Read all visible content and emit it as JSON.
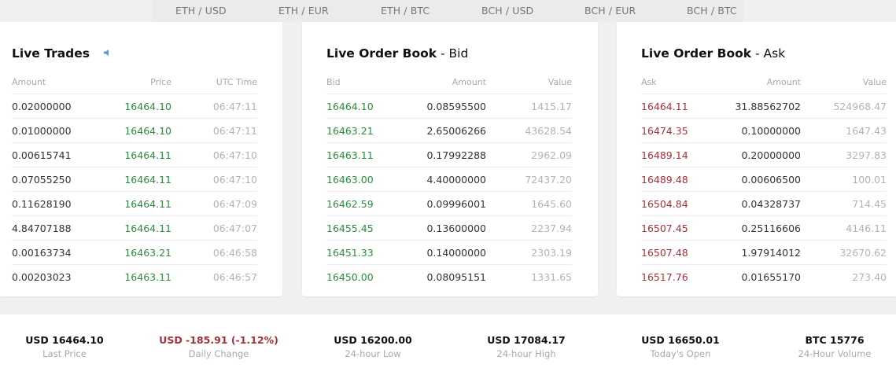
{
  "tabs": [
    "ETH / USD",
    "ETH / EUR",
    "ETH / BTC",
    "BCH / USD",
    "BCH / EUR",
    "BCH / BTC"
  ],
  "trades": {
    "title": "Live Trades",
    "headers": [
      "Amount",
      "Price",
      "UTC Time"
    ],
    "rows": [
      [
        "0.02000000",
        "16464.10",
        "06:47:11"
      ],
      [
        "0.01000000",
        "16464.10",
        "06:47:11"
      ],
      [
        "0.00615741",
        "16464.11",
        "06:47:10"
      ],
      [
        "0.07055250",
        "16464.11",
        "06:47:10"
      ],
      [
        "0.11628190",
        "16464.11",
        "06:47:09"
      ],
      [
        "4.84707188",
        "16464.11",
        "06:47:07"
      ],
      [
        "0.00163734",
        "16463.21",
        "06:46:58"
      ],
      [
        "0.00203023",
        "16463.11",
        "06:46:57"
      ]
    ]
  },
  "bid": {
    "title": "Live Order Book",
    "subtitle": " - Bid",
    "headers": [
      "Bid",
      "Amount",
      "Value"
    ],
    "rows": [
      [
        "16464.10",
        "0.08595500",
        "1415.17"
      ],
      [
        "16463.21",
        "2.65006266",
        "43628.54"
      ],
      [
        "16463.11",
        "0.17992288",
        "2962.09"
      ],
      [
        "16463.00",
        "4.40000000",
        "72437.20"
      ],
      [
        "16462.59",
        "0.09996001",
        "1645.60"
      ],
      [
        "16455.45",
        "0.13600000",
        "2237.94"
      ],
      [
        "16451.33",
        "0.14000000",
        "2303.19"
      ],
      [
        "16450.00",
        "0.08095151",
        "1331.65"
      ]
    ]
  },
  "ask": {
    "title": "Live Order Book",
    "subtitle": " - Ask",
    "headers": [
      "Ask",
      "Amount",
      "Value"
    ],
    "rows": [
      [
        "16464.11",
        "31.88562702",
        "524968.47"
      ],
      [
        "16474.35",
        "0.10000000",
        "1647.43"
      ],
      [
        "16489.14",
        "0.20000000",
        "3297.83"
      ],
      [
        "16489.48",
        "0.00606500",
        "100.01"
      ],
      [
        "16504.84",
        "0.04328737",
        "714.45"
      ],
      [
        "16507.45",
        "0.25116606",
        "4146.11"
      ],
      [
        "16507.48",
        "1.97914012",
        "32670.62"
      ],
      [
        "16517.76",
        "0.01655170",
        "273.40"
      ]
    ]
  },
  "stats": [
    {
      "value": "USD 16464.10",
      "label": "Last Price",
      "negative": false
    },
    {
      "value": "USD -185.91 (-1.12%)",
      "label": "Daily Change",
      "negative": true
    },
    {
      "value": "USD 16200.00",
      "label": "24-hour Low",
      "negative": false
    },
    {
      "value": "USD 17084.17",
      "label": "24-hour High",
      "negative": false
    },
    {
      "value": "USD 16650.01",
      "label": "Today's Open",
      "negative": false
    },
    {
      "value": "BTC 15776",
      "label": "24-Hour Volume",
      "negative": false
    }
  ],
  "colors": {
    "buy": "#2e8b3e",
    "sell": "#a3333a",
    "sound_icon": "#5b9bd5"
  },
  "icons": {
    "sound": "speaker-icon"
  }
}
